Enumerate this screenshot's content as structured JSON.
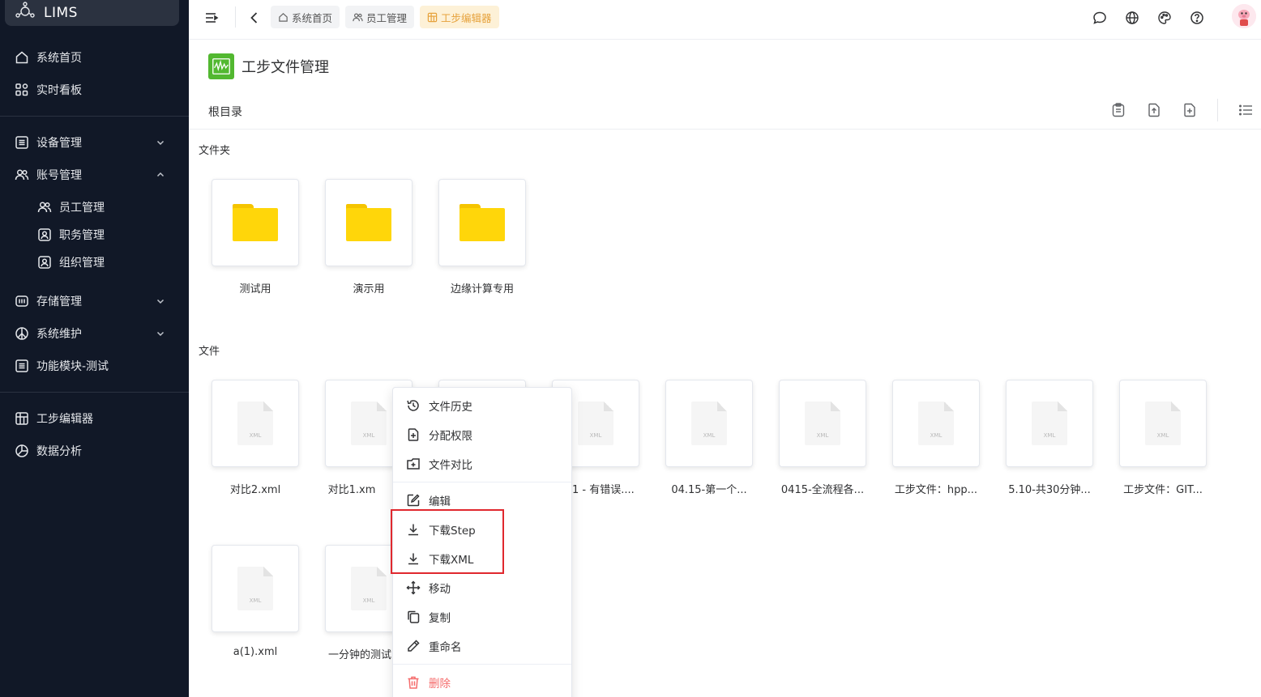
{
  "app": {
    "name": "LIMS"
  },
  "sidebar": {
    "items": [
      {
        "label": "系统首页",
        "icon": "home-icon"
      },
      {
        "label": "实时看板",
        "icon": "dashboard-icon"
      },
      {
        "label": "设备管理",
        "icon": "device-icon"
      },
      {
        "label": "账号管理",
        "icon": "users-icon"
      },
      {
        "label": "员工管理",
        "icon": "users-icon"
      },
      {
        "label": "职务管理",
        "icon": "id-card-icon"
      },
      {
        "label": "组织管理",
        "icon": "id-card-icon"
      },
      {
        "label": "存储管理",
        "icon": "storage-icon"
      },
      {
        "label": "系统维护",
        "icon": "peace-icon"
      },
      {
        "label": "功能模块-测试",
        "icon": "module-icon"
      },
      {
        "label": "工步编辑器",
        "icon": "grid-icon"
      },
      {
        "label": "数据分析",
        "icon": "pie-chart-icon"
      }
    ]
  },
  "topbar": {
    "breadcrumbs": [
      {
        "label": "系统首页",
        "icon": "home-icon"
      },
      {
        "label": "员工管理",
        "icon": "users-icon"
      },
      {
        "label": "工步编辑器",
        "icon": "grid-icon"
      }
    ]
  },
  "page": {
    "title": "工步文件管理"
  },
  "toolbar": {
    "path": "根目录"
  },
  "sections": {
    "folders": "文件夹",
    "files": "文件"
  },
  "folders": [
    "测试用",
    "演示用",
    "边缘计算专用"
  ],
  "files": [
    "对比2.xml",
    "对比1.xm",
    "1 - 有错误....",
    "04.15-第一个...",
    "0415-全流程各...",
    "工步文件：hpp...",
    "5.10-共30分钟...",
    "工步文件：GIT...",
    "a(1).xml",
    "一分钟的测试"
  ],
  "file_badge": "XML",
  "context_menu": {
    "items": [
      {
        "label": "文件历史",
        "icon": "history-icon"
      },
      {
        "label": "分配权限",
        "icon": "permission-icon"
      },
      {
        "label": "文件对比",
        "icon": "compare-icon"
      },
      {
        "label": "编辑",
        "icon": "edit-icon"
      },
      {
        "label": "下载Step",
        "icon": "download-icon"
      },
      {
        "label": "下载XML",
        "icon": "download-icon"
      },
      {
        "label": "移动",
        "icon": "move-icon"
      },
      {
        "label": "复制",
        "icon": "copy-icon"
      },
      {
        "label": "重命名",
        "icon": "rename-icon"
      },
      {
        "label": "删除",
        "icon": "delete-icon"
      }
    ]
  },
  "colors": {
    "sidebar_bg": "#111827",
    "accent_folder": "#ffd60a",
    "page_icon": "#52b830",
    "danger": "#f56c6c",
    "highlight": "#e0282e"
  }
}
